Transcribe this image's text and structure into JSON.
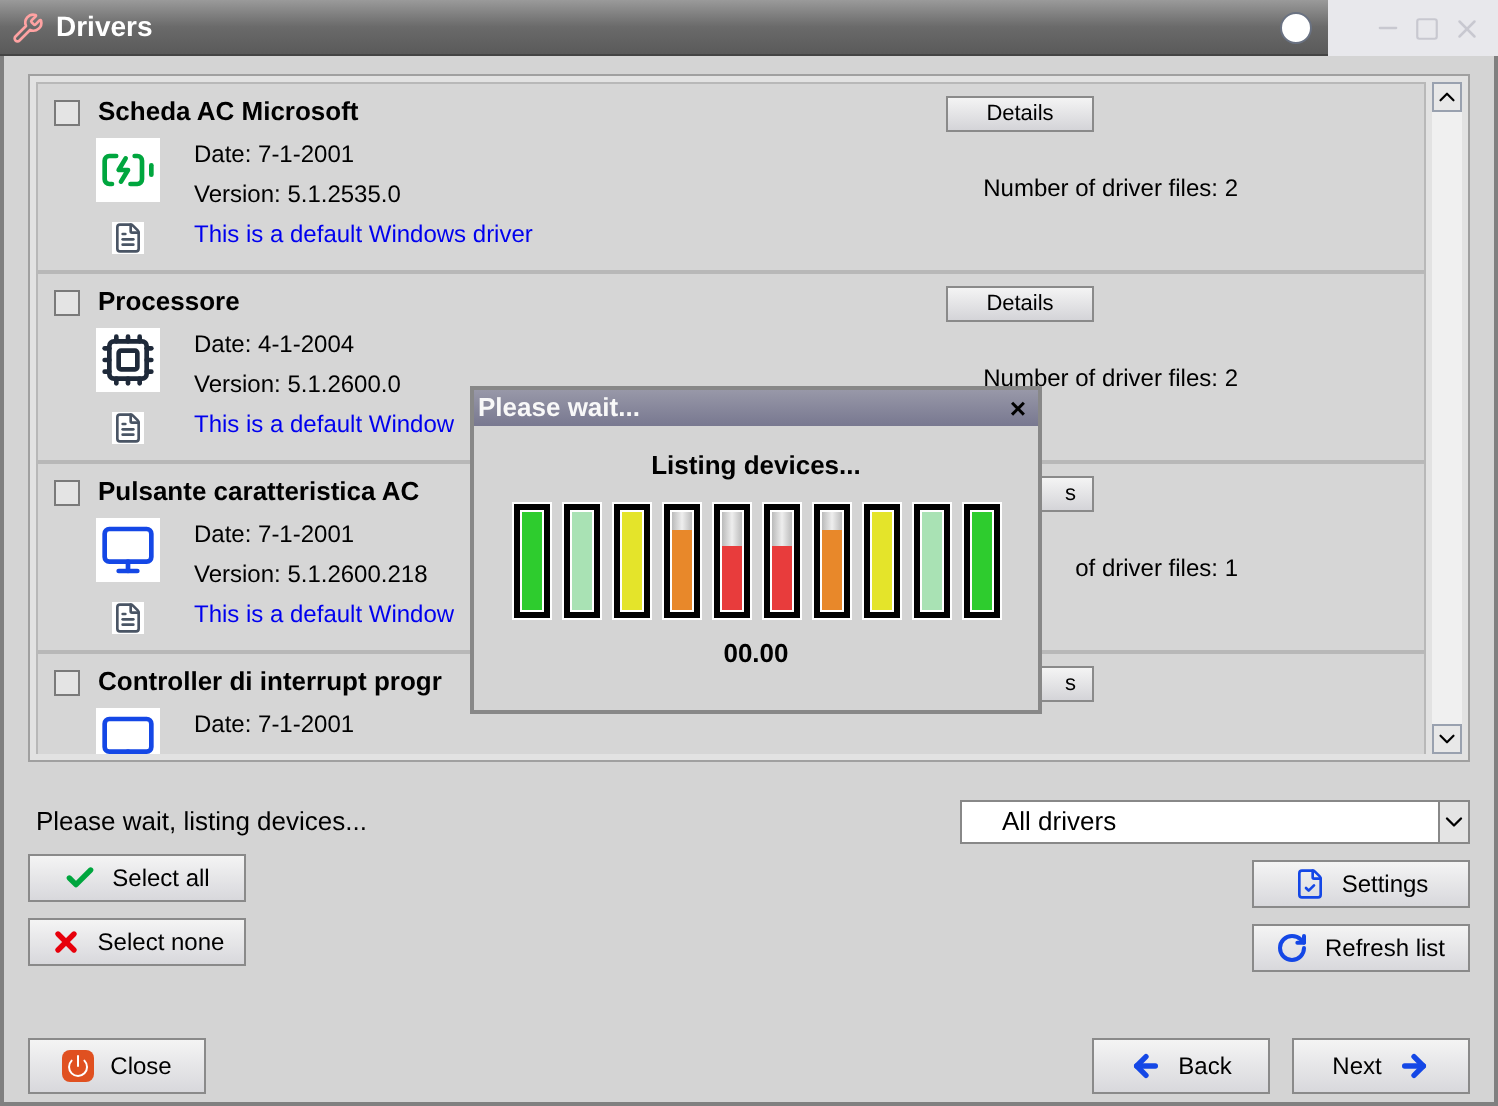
{
  "window": {
    "title": "Drivers"
  },
  "drivers": [
    {
      "kind": "battery",
      "name": "Scheda AC Microsoft",
      "checked": false,
      "details": "Details",
      "date": "Date: 7-1-2001",
      "version": "Version: 5.1.2535.0",
      "files": "Number of driver files: 2",
      "note": "This is a default Windows driver"
    },
    {
      "kind": "chip",
      "name": "Processore",
      "checked": false,
      "details": "Details",
      "date": "Date: 4-1-2004",
      "version": "Version: 5.1.2600.0",
      "files": "Number of driver files: 2",
      "note": "This is a default Window"
    },
    {
      "kind": "monitor",
      "name": "Pulsante caratteristica AC",
      "checked": false,
      "details": "s",
      "date": "Date: 7-1-2001",
      "version": "Version: 5.1.2600.218",
      "files": "of driver files: 1",
      "note": "This is a default Window"
    },
    {
      "kind": "monitor",
      "name": "Controller di interrupt progr",
      "checked": false,
      "details": "s",
      "date": "Date: 7-1-2001"
    }
  ],
  "dialog": {
    "title": "Please wait...",
    "close": "×",
    "message": "Listing devices...",
    "reading": "00.00",
    "bars": [
      {
        "level": 1,
        "color": "#2ecc2e"
      },
      {
        "level": 1,
        "color": "#a9e2b4"
      },
      {
        "level": 1,
        "color": "#e4e42a"
      },
      {
        "level": 0.8,
        "color": "#e8882a"
      },
      {
        "level": 0.65,
        "color": "#e83c3c"
      },
      {
        "level": 0.65,
        "color": "#e83c3c"
      },
      {
        "level": 0.8,
        "color": "#e8882a"
      },
      {
        "level": 1,
        "color": "#e4e42a"
      },
      {
        "level": 1,
        "color": "#a9e2b4"
      },
      {
        "level": 1,
        "color": "#2ecc2e"
      }
    ]
  },
  "status": "Please wait, listing devices...",
  "filter": {
    "value": "All drivers"
  },
  "buttons": {
    "select_all": "Select all",
    "select_none": "Select none",
    "settings": "Settings",
    "refresh": "Refresh list",
    "close": "Close",
    "back": "Back",
    "next": "Next"
  }
}
